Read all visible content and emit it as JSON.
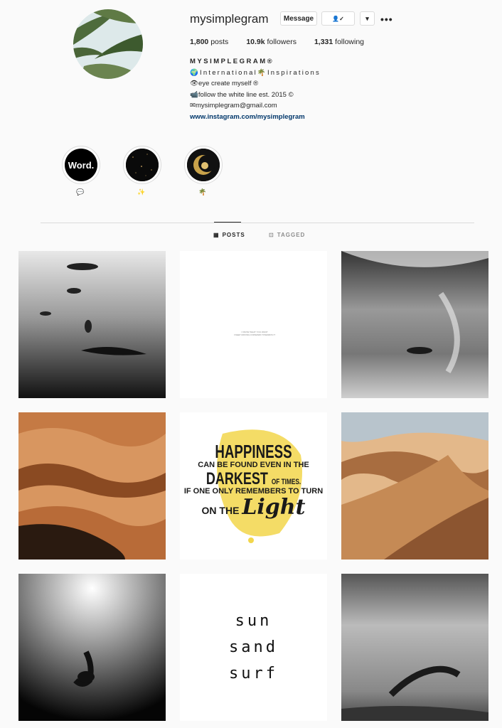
{
  "profile": {
    "username": "mysimplegram",
    "message_label": "Message",
    "follow_icon_text": "👤✓",
    "dropdown_icon": "▾",
    "more_icon": "•••",
    "stats": {
      "posts_count": "1,800",
      "posts_label": "posts",
      "followers_count": "10.9k",
      "followers_label": "followers",
      "following_count": "1,331",
      "following_label": "following"
    },
    "bio": {
      "name": "MYSIMPLEGRAM®",
      "line1": "🌍International🌴Inspirations",
      "line2": "👁eye create myself ®",
      "line3": "📹follow the white line est. 2015 ©",
      "line4": "✉mysimplegram@gmail.com",
      "link": "www.instagram.com/mysimplegram"
    }
  },
  "highlights": [
    {
      "label": "💬",
      "cover_text": "Word."
    },
    {
      "label": "✨",
      "cover_text": ""
    },
    {
      "label": "🌴",
      "cover_text": ""
    }
  ],
  "tabs": {
    "posts": {
      "icon": "▦",
      "label": "POSTS"
    },
    "tagged": {
      "icon": "⊡",
      "label": "TAGGED"
    }
  },
  "posts": {
    "quote_small": "I KNOW WHAT YOU WANT\nI KEEP MOVING FORWARD TOWARDS IT",
    "happiness": {
      "line1": "HAPPINESS",
      "line2": "CAN BE FOUND EVEN IN THE",
      "line3": "DARKEST",
      "line3b": "OF TIMES.",
      "line4": "IF ONE ONLY REMEMBERS TO TURN",
      "line5": "ON THE",
      "line5b": "Light"
    },
    "sun_sand_surf": [
      "sun",
      "sand",
      "surf"
    ]
  }
}
